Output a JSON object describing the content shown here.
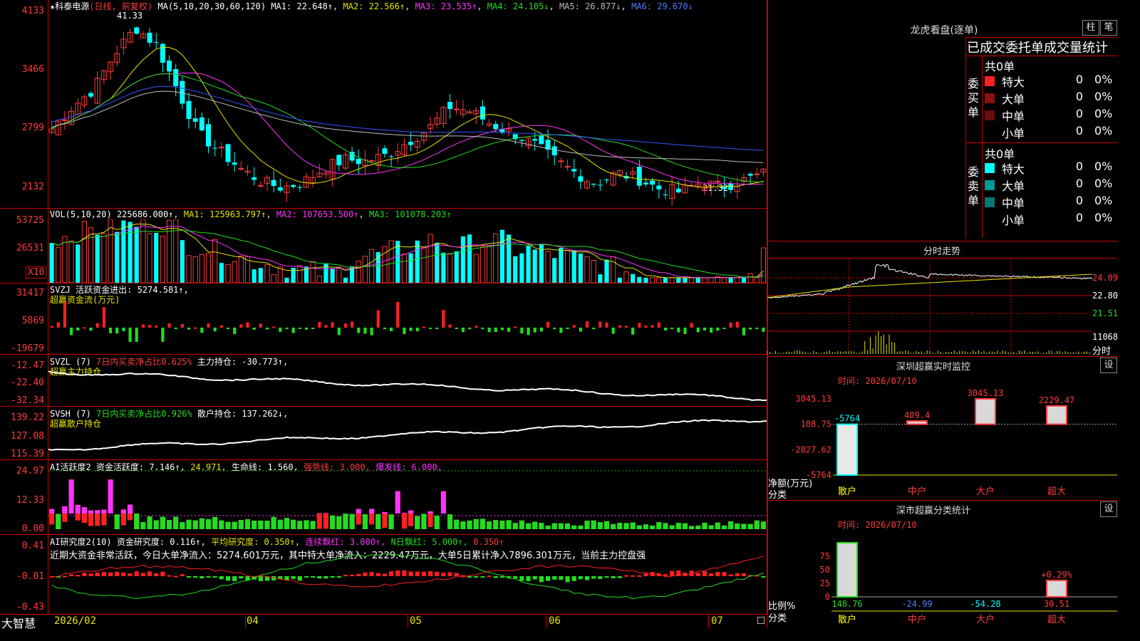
{
  "chart_data": [
    {
      "type": "candlestick",
      "title": "科泰电源",
      "subtitle": "(日线, 前复权)",
      "y_ticks": [
        "4133",
        "3466",
        "2799",
        "2132"
      ],
      "annotations": [
        "41.33",
        "21.32"
      ],
      "x_ticks": [
        "2026/02",
        "04",
        "05",
        "06",
        "07"
      ],
      "close_path_normalized_example": [
        28.5,
        31,
        33,
        37,
        40,
        38,
        33,
        28,
        26,
        24,
        22.5,
        21.8,
        22.4,
        24,
        25,
        24.8,
        25.5,
        27,
        28.5,
        31,
        30.5,
        29,
        28,
        26.8,
        25,
        23.5,
        22.2,
        23.5,
        22.8,
        21.7,
        21.32,
        22.4,
        21.9,
        22.6,
        23.4
      ],
      "ma": [
        {
          "name": "MA1",
          "label": "MA1: 22.648↑",
          "color": "#ffffff"
        },
        {
          "name": "MA2",
          "label": "MA2: 22.566↑",
          "color": "#e6e600"
        },
        {
          "name": "MA3",
          "label": "MA3: 23.535↑",
          "color": "#ff33ff"
        },
        {
          "name": "MA4",
          "label": "MA4: 24.105↓",
          "color": "#22dd22"
        },
        {
          "name": "MA5",
          "label": "MA5: 26.877↓",
          "color": "#bbbbbb"
        },
        {
          "name": "MA6",
          "label": "MA6: 29.670↓",
          "color": "#3355ff"
        }
      ],
      "header_prefix": "★科泰电源",
      "header_mode": "(日线, 前复权)",
      "header_ma": "MA(5,10,20,30,60,120)"
    },
    {
      "type": "bar",
      "name": "VOL(5,10,20)",
      "value_label": "225686.000↑",
      "ma_labels": [
        "MA1: 125963.797↑",
        "MA2: 107653.500↑",
        "MA3: 101078.203↑"
      ],
      "y_ticks": [
        "53725",
        "26531"
      ],
      "unit_badge": "X10"
    },
    {
      "type": "bar",
      "name": "SVZJ",
      "label": "活跃资金进出: 5274.581↑,",
      "sub": "超赢资金流(万元)",
      "y_ticks": [
        "31417",
        "5869",
        "-19679"
      ]
    },
    {
      "type": "line",
      "name": "SVZL (7)",
      "label1": "7日内买卖净占比0.625%",
      "label2": "主力持仓: -30.773↑,",
      "sub": "超赢主力持仓",
      "y_ticks": [
        "-12.47",
        "-22.40",
        "-32.34"
      ]
    },
    {
      "type": "line",
      "name": "SVSH (7)",
      "label1": "7日内买卖净占比0.926%",
      "label2": "散户持仓: 137.262↓,",
      "sub": "超赢散户持仓",
      "y_ticks": [
        "139.22",
        "127.08",
        "115.39"
      ]
    },
    {
      "type": "bar",
      "name": "AI活跃度2",
      "label1": "资金活跃度: 7.146↑,",
      "label2": "24.971,",
      "label3": "生命线: 1.560,",
      "label4": "强势线: 3.000,",
      "label5": "爆发线: 6.000,",
      "y_ticks": [
        "24.97",
        "12.33",
        "0.00"
      ]
    },
    {
      "type": "bar",
      "name": "AI研究度2(10)",
      "label1": "资金研究度: 0.116↑,",
      "label2": "平均研究度: 0.350↑,",
      "label3": "连续飘红: 3.000↑,",
      "label4": "N日飘红: 5.000↑,",
      "label5": "0.350↑",
      "note": "近期大资金非常活跃，今日大单净流入：5274.601万元，其中特大单净流入：2229.47万元，大单5日累计净入7896.301万元，当前主力控盘强",
      "y_ticks": [
        "0.41",
        "-0.01",
        "-0.43"
      ]
    },
    {
      "type": "bar",
      "title": "深圳超赢实时监控",
      "time_label": "时间: 2026/07/10",
      "categories": [
        "散户",
        "中户",
        "大户",
        "超大"
      ],
      "values": [
        -5764,
        489.4,
        3045.13,
        2229.47
      ],
      "value_labels": [
        "-5764",
        "489.4",
        "3045.13",
        "2229.47"
      ],
      "y_ticks": [
        "3045.13",
        "108.75",
        "-2827.62",
        "-5764"
      ],
      "ylabel": "净额(万元)",
      "xlabel": "分类"
    },
    {
      "type": "bar",
      "title": "深市超赢分类统计",
      "time_label": "时间: 2026/07/10",
      "categories": [
        "散户",
        "中户",
        "大户",
        "超大"
      ],
      "values": [
        148.76,
        -24.99,
        -54.28,
        30.51
      ],
      "extra_label": "+0.29%",
      "y_ticks": [
        "75",
        "50",
        "25",
        "0"
      ],
      "ylabel": "比例%",
      "xlabel": "分类"
    }
  ],
  "footer": {
    "brand": "大智慧"
  },
  "right": {
    "dragon_title": "龙虎看盘(逐单)",
    "btn_zhu": "柱",
    "btn_bi": "笔",
    "stat_title": "已成交委托单成交量统计",
    "buy_label": "委买单",
    "sell_label": "委卖单",
    "buy_total": "共0单",
    "sell_total": "共0单",
    "buy_rows": [
      {
        "name": "特大",
        "val": "0",
        "pct": "0%",
        "color": "#ff2020"
      },
      {
        "name": "大单",
        "val": "0",
        "pct": "0%",
        "color": "#8b1010"
      },
      {
        "name": "中单",
        "val": "0",
        "pct": "0%",
        "color": "#6a0c0c"
      },
      {
        "name": "小单",
        "val": "0",
        "pct": "0%",
        "color": "#000000"
      }
    ],
    "sell_rows": [
      {
        "name": "特大",
        "val": "0",
        "pct": "0%",
        "color": "#00ffff"
      },
      {
        "name": "大单",
        "val": "0",
        "pct": "0%",
        "color": "#009999"
      },
      {
        "name": "中单",
        "val": "0",
        "pct": "0%",
        "color": "#007777"
      },
      {
        "name": "小单",
        "val": "0",
        "pct": "0%",
        "color": "#000000"
      }
    ],
    "fenshi_title": "分时走势",
    "fenshi_ticks": [
      "24.09",
      "22.80",
      "21.51"
    ],
    "fenshi_vol": "11068",
    "fenshi_vol_unit": "分时",
    "set_label": "设"
  }
}
